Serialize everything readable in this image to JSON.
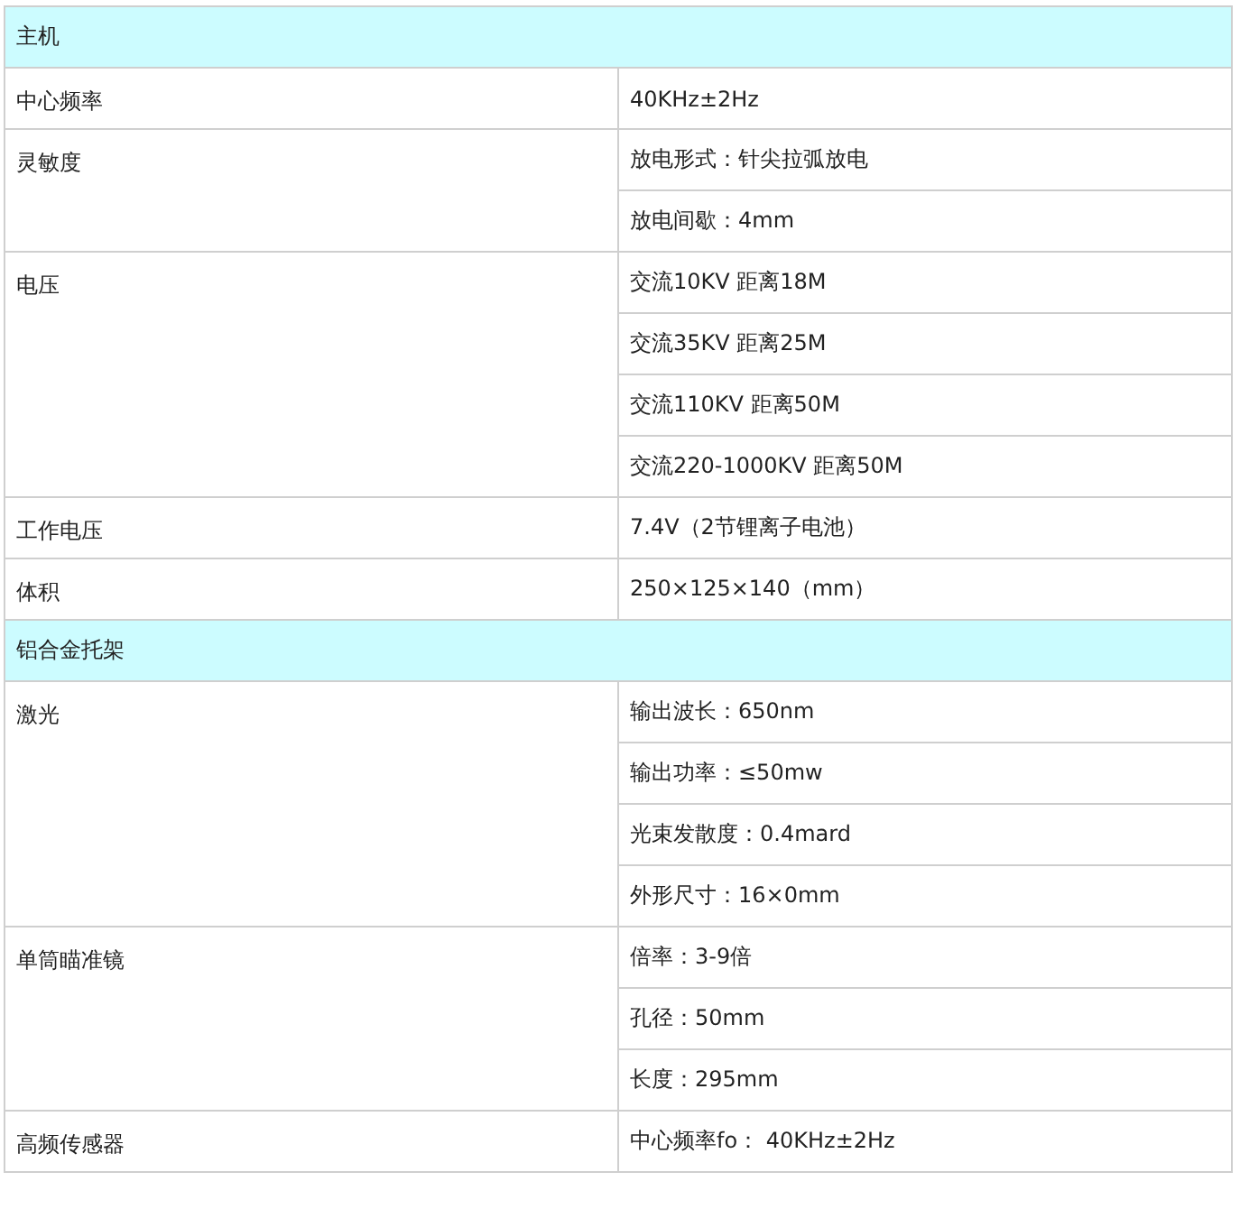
{
  "sections": [
    {
      "title": "主机",
      "rows": [
        {
          "label": "中心频率",
          "values": [
            "40KHz±2Hz"
          ]
        },
        {
          "label": "灵敏度",
          "values": [
            "放电形式：针尖拉弧放电",
            "放电间歇：4mm"
          ]
        },
        {
          "label": "电压",
          "values": [
            "交流10KV 距离18M",
            "交流35KV 距离25M",
            "交流110KV 距离50M",
            "交流220-1000KV 距离50M"
          ]
        },
        {
          "label": "工作电压",
          "values": [
            "7.4V（2节锂离子电池）"
          ]
        },
        {
          "label": "体积",
          "values": [
            "250×125×140（mm）"
          ]
        }
      ]
    },
    {
      "title": "铝合金托架",
      "rows": [
        {
          "label": "激光",
          "values": [
            "输出波长：650nm",
            "输出功率：≤50mw",
            "光束发散度：0.4mard",
            "外形尺寸：16×0mm"
          ]
        },
        {
          "label": "单筒瞄准镜",
          "values": [
            "倍率：3-9倍",
            "孔径：50mm",
            "长度：295mm"
          ]
        },
        {
          "label": "高频传感器",
          "values": [
            "中心频率fo： 40KHz±2Hz"
          ]
        }
      ]
    }
  ]
}
